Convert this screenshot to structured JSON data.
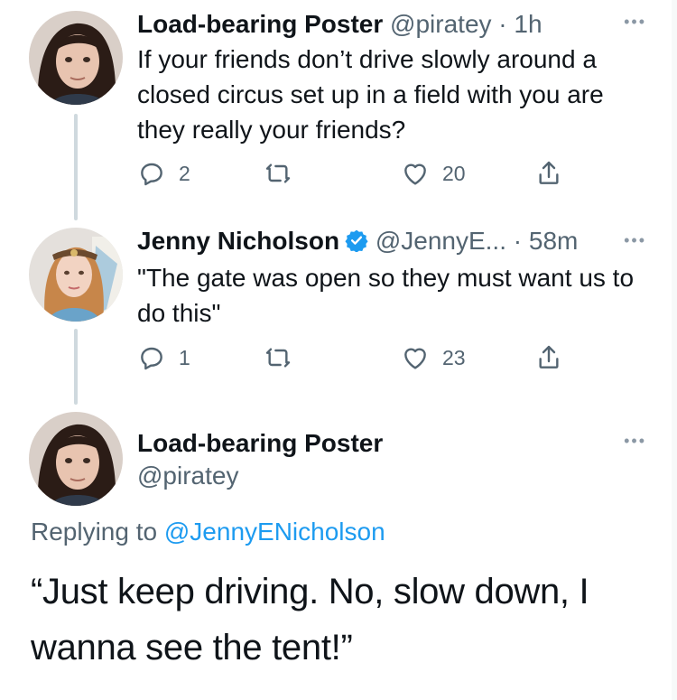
{
  "thread": [
    {
      "author": {
        "name": "Load-bearing Poster",
        "handle": "@piratey"
      },
      "time": "1h",
      "separator": "·",
      "more": "•••",
      "text": "If your friends don’t drive slowly around a closed circus set up in a field with you are they really your friends?",
      "actions": {
        "replies": "2",
        "retweets": "",
        "likes": "20"
      },
      "icons": [
        "reply-icon",
        "retweet-icon",
        "like-icon",
        "share-icon"
      ]
    },
    {
      "author": {
        "name": "Jenny Nicholson",
        "handle": "@JennyE...",
        "verified": true
      },
      "time": "58m",
      "separator": "·",
      "more": "•••",
      "text": "\"The gate was open so they must want us to do this\"",
      "actions": {
        "replies": "1",
        "retweets": "",
        "likes": "23"
      },
      "icons": [
        "reply-icon",
        "retweet-icon",
        "like-icon",
        "share-icon"
      ]
    }
  ],
  "focal": {
    "author": {
      "name": "Load-bearing Poster",
      "handle": "@piratey"
    },
    "more": "•••",
    "replying_prefix": "Replying to",
    "replying_to": "@JennyENicholson",
    "text": "“Just keep driving. No, slow down, I wanna see the tent!”"
  },
  "colors": {
    "text": "#0f1419",
    "secondary": "#536471",
    "link": "#1d9bf0",
    "verified": "#1d9bf0",
    "thread_line": "#cfd9de"
  }
}
